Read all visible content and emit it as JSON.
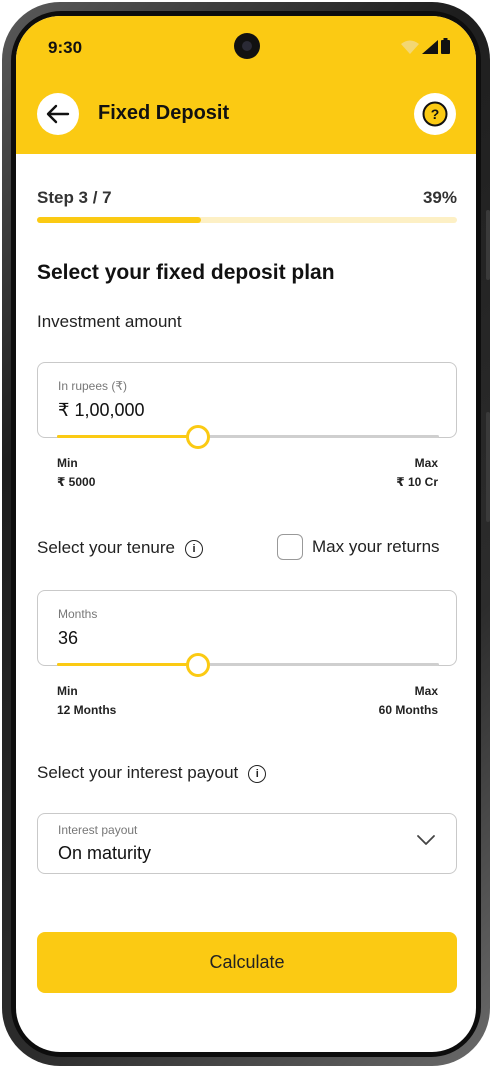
{
  "status_bar": {
    "time": "9:30"
  },
  "header": {
    "title": "Fixed Deposit"
  },
  "progress": {
    "step_text": "Step 3 / 7",
    "percent_text": "39%",
    "percent": 39
  },
  "section_title": "Select your fixed deposit plan",
  "investment": {
    "label": "Investment amount",
    "placeholder": "In rupees (₹)",
    "value": "₹ 1,00,000",
    "slider_fraction": 0.37,
    "min_label": "Min",
    "min_value": "₹ 5000",
    "max_label": "Max",
    "max_value": "₹ 10 Cr"
  },
  "tenure": {
    "label": "Select your tenure",
    "checkbox_label": "Max your returns",
    "checkbox_checked": false,
    "placeholder": "Months",
    "value": "36",
    "slider_fraction": 0.37,
    "min_label": "Min",
    "min_value": "12 Months",
    "max_label": "Max",
    "max_value": "60 Months"
  },
  "payout": {
    "label": "Select your interest payout",
    "placeholder": "Interest payout",
    "value": "On maturity"
  },
  "calculate_button": "Calculate",
  "colors": {
    "accent": "#fbca13",
    "accent_light": "#fdf0c5"
  },
  "icons": [
    "back-arrow-icon",
    "help-question-icon",
    "info-icon",
    "chevron-down-icon",
    "wifi-icon",
    "signal-icon",
    "battery-icon"
  ]
}
